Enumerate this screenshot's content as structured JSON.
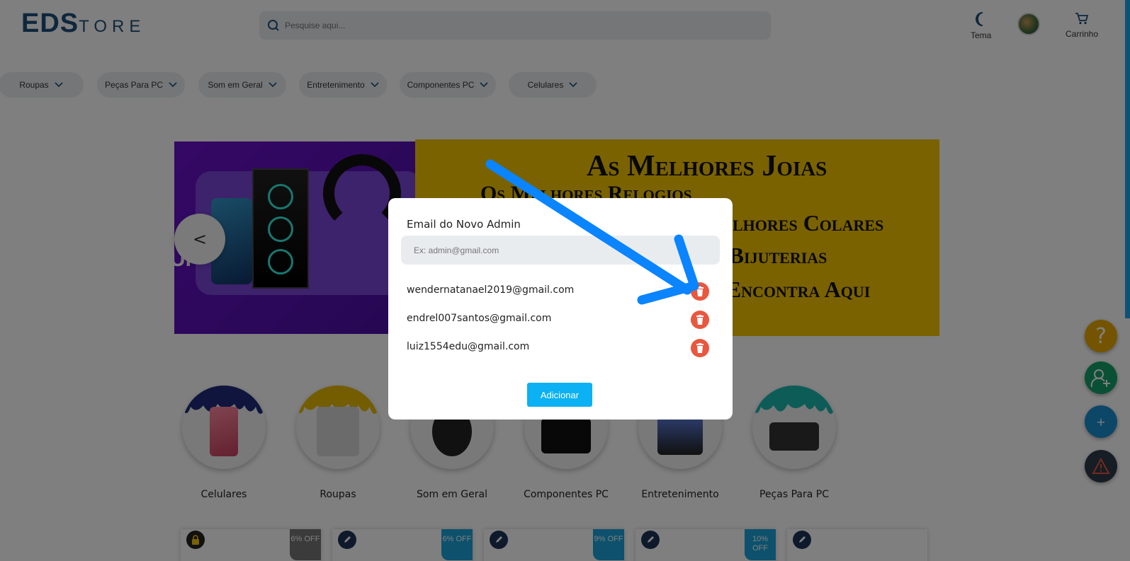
{
  "header": {
    "logo_eds": "EDS",
    "logo_tore": "TORE",
    "search_placeholder": "Pesquise aqui...",
    "theme_label": "Tema",
    "cart_label": "Carrinho"
  },
  "nav": {
    "items": [
      {
        "label": "Roupas"
      },
      {
        "label": "Peças Para PC"
      },
      {
        "label": "Som em Geral"
      },
      {
        "label": "Entretenimento"
      },
      {
        "label": "Componentes PC"
      },
      {
        "label": "Celulares"
      }
    ]
  },
  "banner": {
    "prev_label": "<",
    "left_edge_text": "UI",
    "lines": [
      "As Melhores Joias",
      "Os Melhores Relogios",
      "Os Melhores Colares",
      "e Bijuterias",
      "Você Encontra Aqui"
    ]
  },
  "categories": [
    {
      "label": "Celulares",
      "drip": "#1e2a78"
    },
    {
      "label": "Roupas",
      "drip": "#e8b800"
    },
    {
      "label": "Som em Geral",
      "drip": "#2aa640"
    },
    {
      "label": "Componentes PC",
      "drip": "#cc2230"
    },
    {
      "label": "Entretenimento",
      "drip": "#3a55c8"
    },
    {
      "label": "Peças Para PC",
      "drip": "#1ab8b0"
    }
  ],
  "cards": [
    {
      "discount": "6% OFF",
      "action": "lock"
    },
    {
      "discount": "6% OFF",
      "action": "edit"
    },
    {
      "discount": "9% OFF",
      "action": "edit"
    },
    {
      "discount": "10% OFF",
      "action": "edit"
    },
    {
      "discount": "",
      "action": "edit"
    }
  ],
  "fabs": {
    "help_label": "?",
    "add_label": "+"
  },
  "modal": {
    "title": "Email do Novo Admin",
    "input_placeholder": "Ex: admin@gmail.com",
    "admins": [
      {
        "email": "wendernatanael2019@gmail.com"
      },
      {
        "email": "endrel007santos@gmail.com"
      },
      {
        "email": "luiz1554edu@gmail.com"
      }
    ],
    "add_button": "Adicionar"
  },
  "colors": {
    "accent": "#0bb1f2",
    "delete": "#e9573f",
    "logo": "#1f4f7a",
    "banner_yellow": "#f5c400",
    "banner_purple": "#6a11cb",
    "arrow": "#0a84ff"
  }
}
